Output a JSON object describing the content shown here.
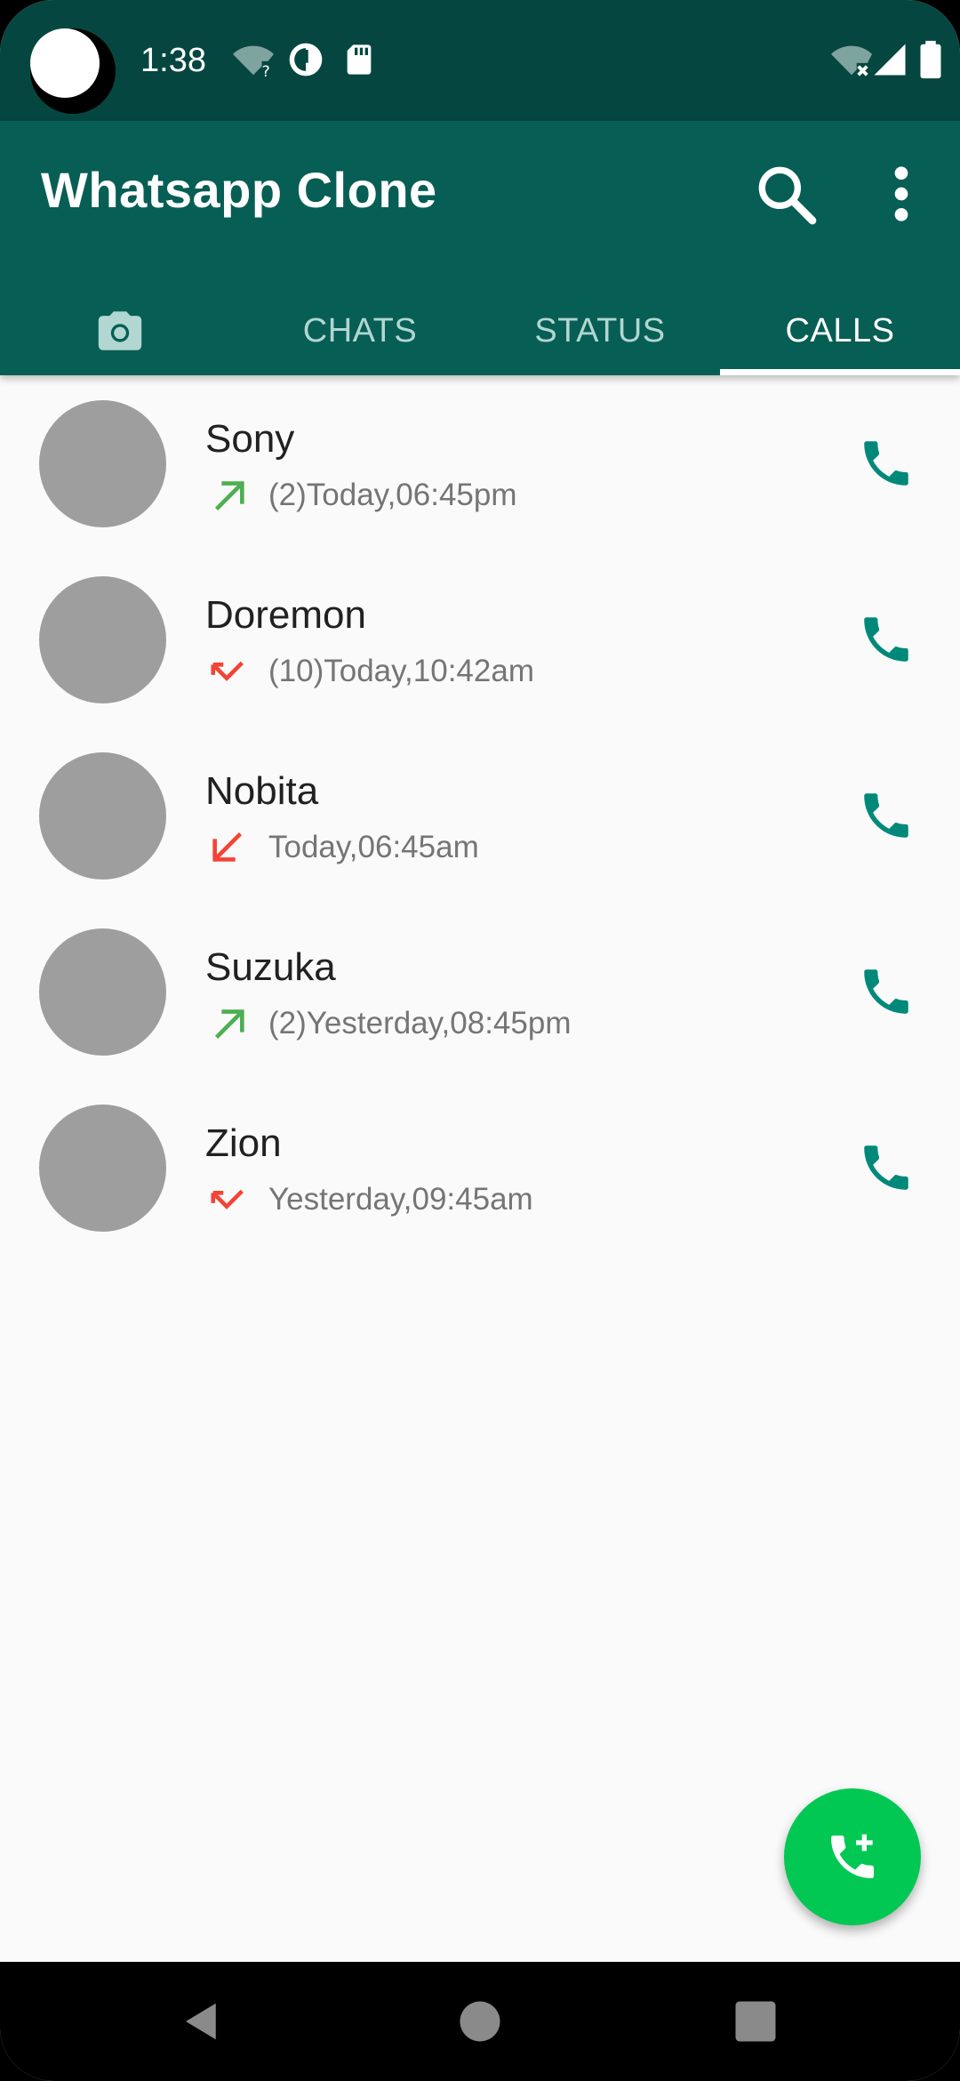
{
  "status_bar": {
    "time": "1:38",
    "icons_left": [
      "wifi-question-icon",
      "data-saver-icon",
      "sd-card-icon"
    ],
    "icons_right": [
      "wifi-off-icon",
      "signal-icon",
      "battery-icon"
    ]
  },
  "app_bar": {
    "title": "Whatsapp Clone",
    "actions": [
      "search-icon",
      "more-vert-icon"
    ]
  },
  "tabs": [
    {
      "label": "",
      "icon": "camera-icon"
    },
    {
      "label": "CHATS"
    },
    {
      "label": "STATUS"
    },
    {
      "label": "CALLS",
      "active": true
    }
  ],
  "calls": [
    {
      "name": "Sony",
      "detail": "(2)Today,06:45pm",
      "direction": "outgoing",
      "direction_color": "#4caf50"
    },
    {
      "name": "Doremon",
      "detail": "(10)Today,10:42am",
      "direction": "missed",
      "direction_color": "#f44336"
    },
    {
      "name": "Nobita",
      "detail": "Today,06:45am",
      "direction": "incoming",
      "direction_color": "#f44336"
    },
    {
      "name": "Suzuka",
      "detail": "(2)Yesterday,08:45pm",
      "direction": "outgoing",
      "direction_color": "#4caf50"
    },
    {
      "name": "Zion",
      "detail": "Yesterday,09:45am",
      "direction": "missed",
      "direction_color": "#f44336"
    }
  ],
  "colors": {
    "primary_dark": "#054740",
    "primary": "#075e54",
    "accent_call": "#00897b",
    "fab": "#00c853"
  },
  "fab": {
    "icon": "add-call-icon"
  },
  "nav_bar": [
    "back-icon",
    "home-icon",
    "recents-icon"
  ]
}
